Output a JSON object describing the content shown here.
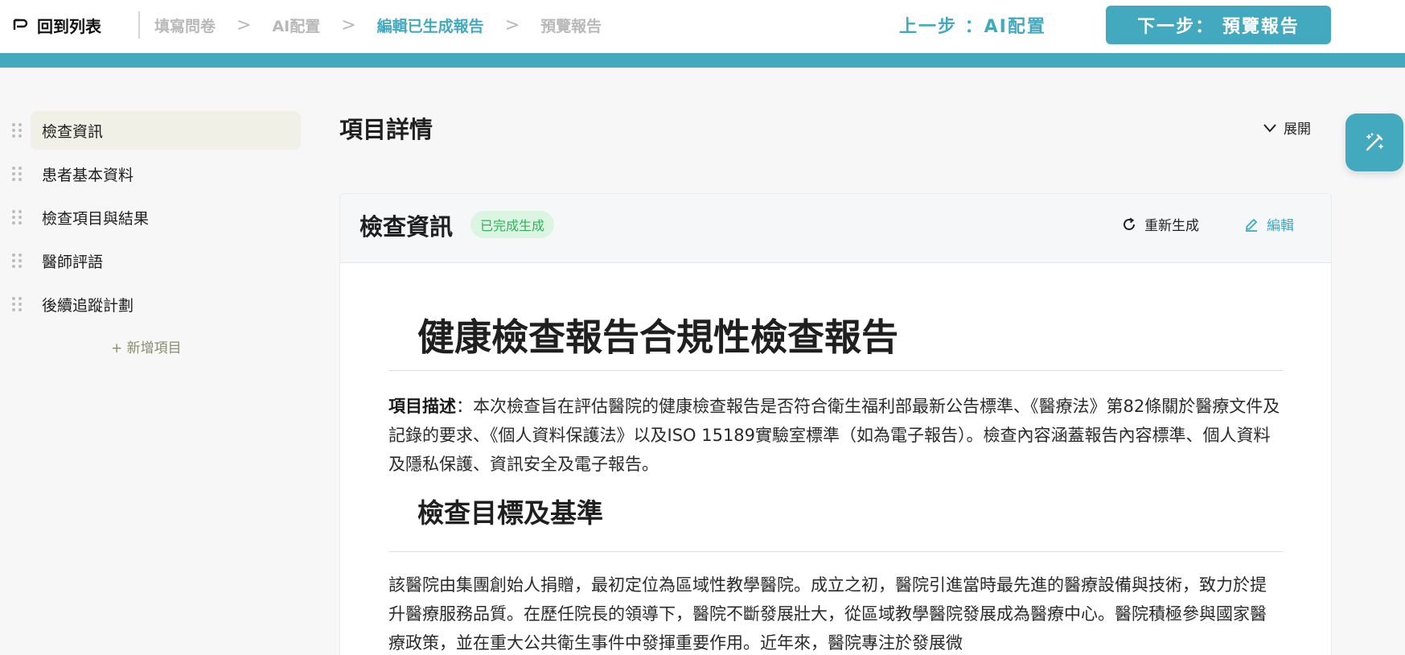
{
  "header": {
    "back_label": "回到列表",
    "steps": [
      {
        "label": "填寫問卷",
        "active": false
      },
      {
        "label": "AI配置",
        "active": false
      },
      {
        "label": "編輯已生成報告",
        "active": true
      },
      {
        "label": "預覽報告",
        "active": false
      }
    ],
    "step_separator": ">",
    "prev_button": "上一步 ：AI配置",
    "next_button": "下一步： 預覽報告"
  },
  "sidebar": {
    "items": [
      {
        "label": "檢查資訊",
        "active": true
      },
      {
        "label": "患者基本資料",
        "active": false
      },
      {
        "label": "檢查項目與結果",
        "active": false
      },
      {
        "label": "醫師評語",
        "active": false
      },
      {
        "label": "後續追蹤計劃",
        "active": false
      }
    ],
    "add_item": "+ 新增項目"
  },
  "main": {
    "title": "項目詳情",
    "expand_label": "展開"
  },
  "card": {
    "title": "檢查資訊",
    "status": "已完成生成",
    "regenerate_label": "重新生成",
    "edit_label": "編輯",
    "doc": {
      "h1": "健康檢查報告合規性檢查報告",
      "para_label": "項目描述",
      "para_text": "：本次檢查旨在評估醫院的健康檢查報告是否符合衛生福利部最新公告標準、《醫療法》第82條關於醫療文件及記錄的要求、《個人資料保護法》以及ISO 15189實驗室標準（如為電子報告）。檢查內容涵蓋報告內容標準、個人資料及隱私保護、資訊安全及電子報告。",
      "h2": "檢查目標及基準",
      "para2_text": "該醫院由集團創始人捐贈，最初定位為區域性教學醫院。成立之初，醫院引進當時最先進的醫療設備與技術，致力於提升醫療服務品質。在歷任院長的領導下，醫院不斷發展壯大，從區域教學醫院發展成為醫療中心。醫院積極參與國家醫療政策，並在重大公共衛生事件中發揮重要作用。近年來，醫院專注於發展微"
    }
  },
  "colors": {
    "accent": "#43a9bf",
    "active_nav_bg": "#f1f0e6",
    "status_green": "#2fb25a",
    "status_green_bg": "#dcf5e3"
  }
}
